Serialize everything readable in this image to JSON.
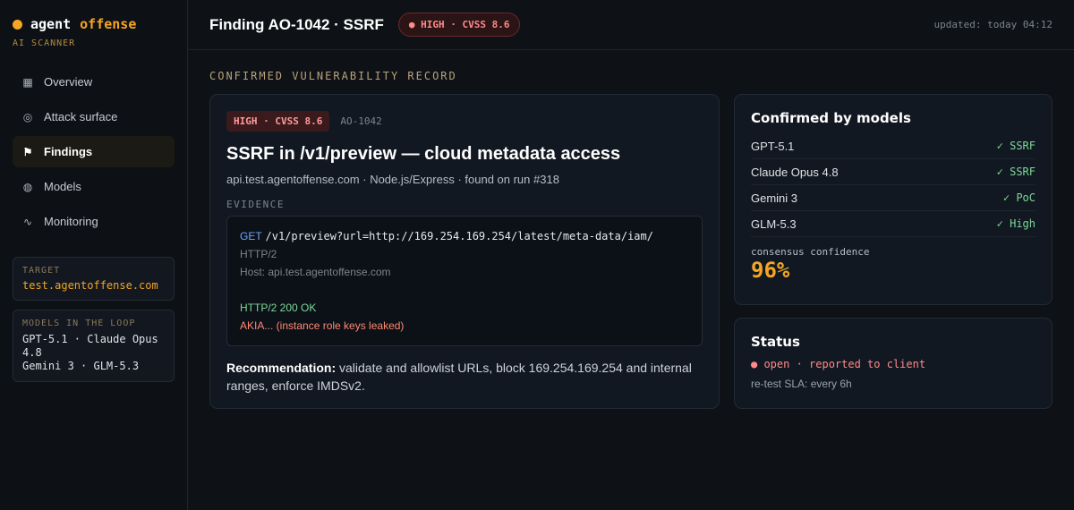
{
  "brand": {
    "name_a": "agent",
    "name_b": "offense",
    "subtitle": "AI SCANNER"
  },
  "nav": [
    {
      "label": "Overview",
      "icon": "grid-icon",
      "glyph": "▦"
    },
    {
      "label": "Attack surface",
      "icon": "target-icon",
      "glyph": "◎"
    },
    {
      "label": "Findings",
      "icon": "flag-icon",
      "glyph": "⚑",
      "active": true
    },
    {
      "label": "Models",
      "icon": "globe-icon",
      "glyph": "◍"
    },
    {
      "label": "Monitoring",
      "icon": "pulse-icon",
      "glyph": "∿"
    }
  ],
  "target": {
    "label": "TARGET",
    "value": "test.agentoffense.com"
  },
  "models_loop": {
    "label": "MODELS IN THE LOOP",
    "line1": "GPT-5.1 · Claude Opus 4.8",
    "line2": "Gemini 3 · GLM-5.3"
  },
  "header": {
    "title": "Finding AO-1042 · SSRF",
    "badge": "● HIGH · CVSS 8.6",
    "updated": "updated: today 04:12"
  },
  "section_title": "CONFIRMED VULNERABILITY RECORD",
  "finding": {
    "severity_tag": "HIGH · CVSS 8.6",
    "id": "AO-1042",
    "title": "SSRF in /v1/preview — cloud metadata access",
    "meta": "api.test.agentoffense.com · Node.js/Express · found on run #318",
    "evidence_label": "EVIDENCE",
    "evidence": {
      "method": "GET",
      "path": "/v1/preview?url=http://169.254.169.254/latest/meta-data/iam/",
      "protocol": "HTTP/2",
      "host": "Host: api.test.agentoffense.com",
      "response": "HTTP/2 200 OK",
      "leak": "AKIA... (instance role keys leaked)"
    },
    "recommendation_label": "Recommendation:",
    "recommendation": "validate and allowlist URLs, block 169.254.169.254 and internal ranges, enforce IMDSv2."
  },
  "confirmed": {
    "title": "Confirmed by models",
    "models": [
      {
        "name": "GPT-5.1",
        "verdict": "✓ SSRF"
      },
      {
        "name": "Claude Opus 4.8",
        "verdict": "✓ SSRF"
      },
      {
        "name": "Gemini 3",
        "verdict": "✓ PoC"
      },
      {
        "name": "GLM-5.3",
        "verdict": "✓ High"
      }
    ],
    "consensus_label": "consensus confidence",
    "consensus_value": "96%"
  },
  "status": {
    "title": "Status",
    "state": "● open · reported to client",
    "sla": "re-test SLA: every 6h"
  },
  "colors": {
    "accent": "#f5a623",
    "danger": "#ff8a8a",
    "success": "#7ed99a",
    "background": "#0e1116"
  }
}
